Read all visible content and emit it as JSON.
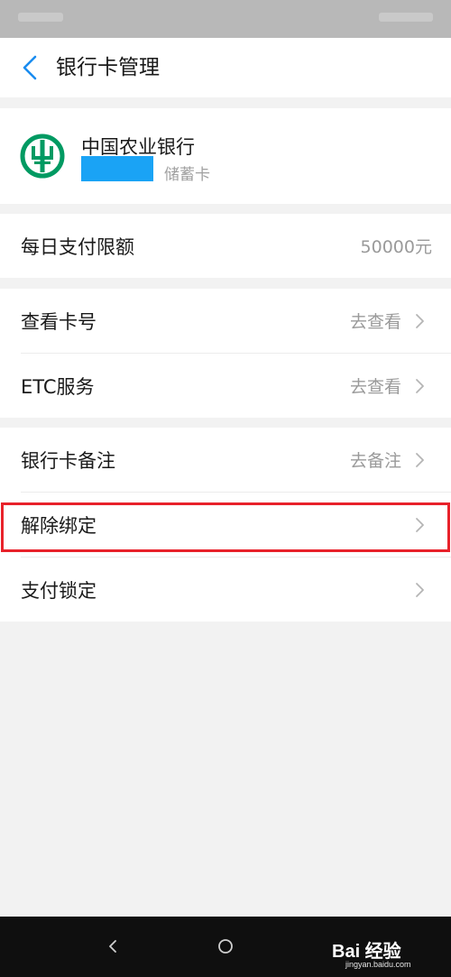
{
  "header": {
    "title": "银行卡管理"
  },
  "card": {
    "bank_name": "中国农业银行",
    "card_type": "储蓄卡"
  },
  "limit_row": {
    "label": "每日支付限额",
    "value": "50000元"
  },
  "rows_group1": [
    {
      "label": "查看卡号",
      "value": "去查看"
    },
    {
      "label": "ETC服务",
      "value": "去查看"
    }
  ],
  "rows_group2": [
    {
      "label": "银行卡备注",
      "value": "去备注"
    },
    {
      "label": "解除绑定",
      "value": ""
    },
    {
      "label": "支付锁定",
      "value": ""
    }
  ],
  "watermark": {
    "text": "Bai 经验",
    "url": "jingyan.baidu.com"
  },
  "colors": {
    "accent": "#1a8cf0",
    "bank_green": "#009a62",
    "highlight": "#e8212a",
    "mask": "#1aa3f5"
  }
}
